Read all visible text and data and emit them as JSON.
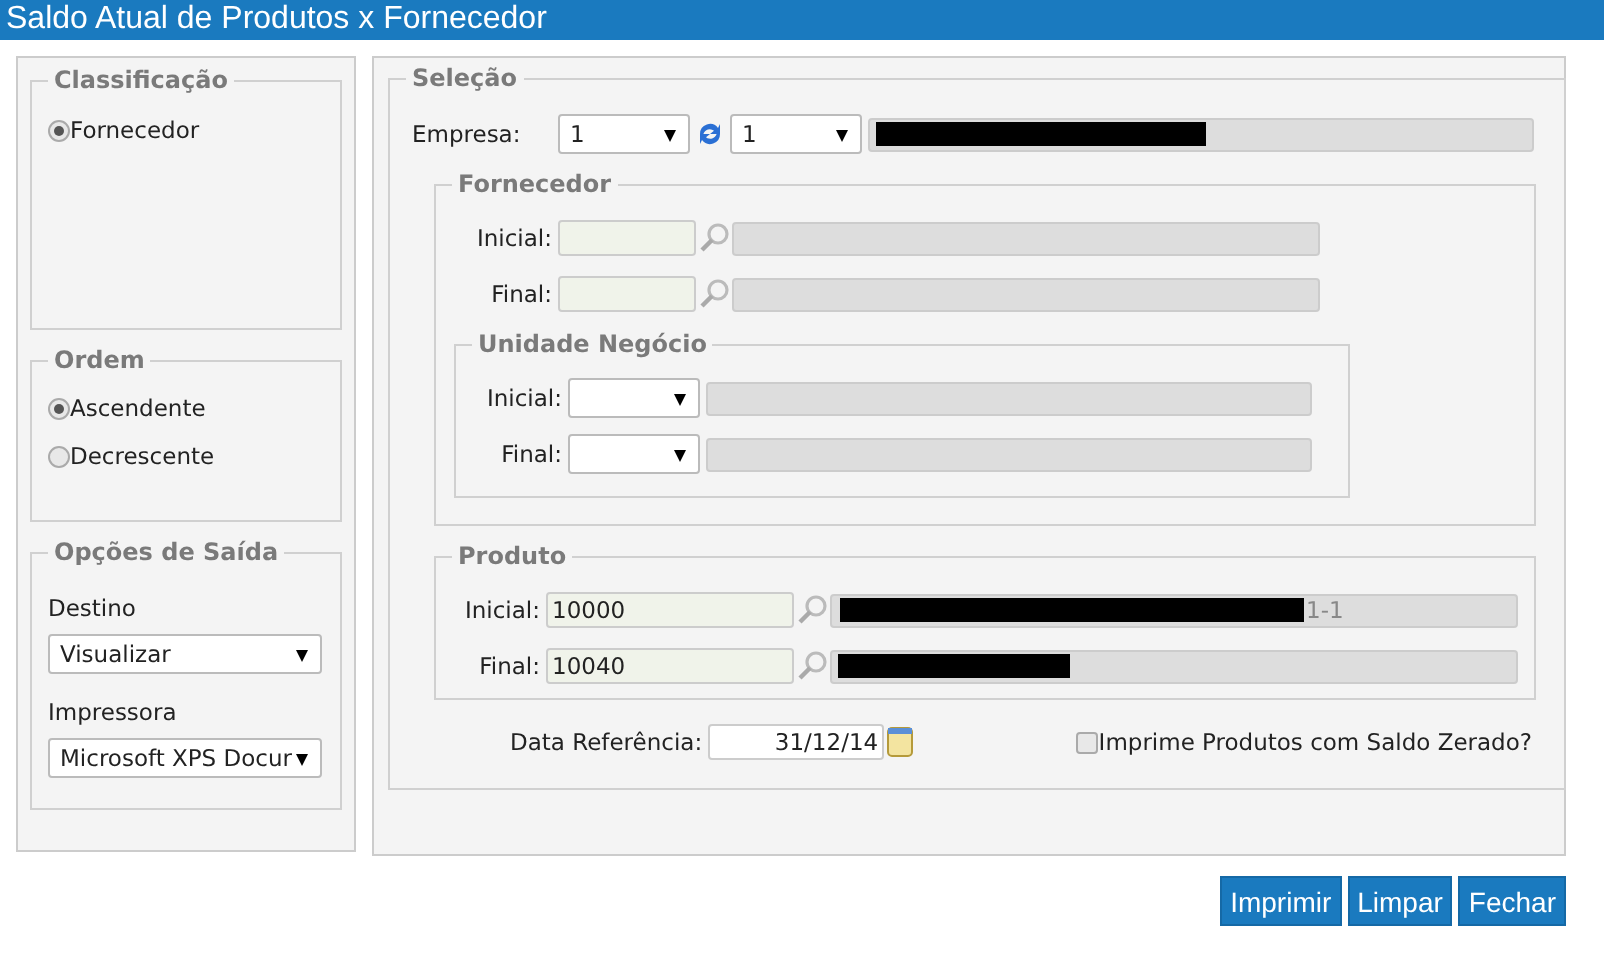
{
  "window": {
    "title": "Saldo Atual de Produtos x Fornecedor"
  },
  "classificacao": {
    "legend": "Classificação",
    "options": [
      {
        "label": "Fornecedor",
        "selected": true
      }
    ]
  },
  "ordem": {
    "legend": "Ordem",
    "options": [
      {
        "label": "Ascendente",
        "selected": true
      },
      {
        "label": "Decrescente",
        "selected": false
      }
    ]
  },
  "saida": {
    "legend": "Opções de Saída",
    "fields": [
      {
        "label": "Destino",
        "value": "Visualizar"
      },
      {
        "label": "Impressora",
        "value": "Microsoft XPS Docur"
      }
    ]
  },
  "selecao": {
    "legend": "Seleção",
    "empresa": {
      "label": "Empresa:",
      "value_1": "1",
      "value_2": "1",
      "description_redacted": true
    },
    "fornecedor": {
      "legend": "Fornecedor",
      "rows": [
        {
          "label": "Inicial:"
        },
        {
          "label": "Final:"
        }
      ]
    },
    "unidade": {
      "legend": "Unidade Negócio",
      "rows": [
        {
          "label": "Inicial:"
        },
        {
          "label": "Final:"
        }
      ]
    },
    "produto": {
      "legend": "Produto",
      "rows": [
        {
          "label": "Inicial:",
          "value": "10000",
          "description": "1-1",
          "redacted": true
        },
        {
          "label": "Final:",
          "value": "10040",
          "redacted": true
        }
      ]
    },
    "data_referencia": {
      "label": "Data Referência:",
      "value": "31/12/14"
    },
    "zerado": {
      "label": "Imprime Produtos com Saldo Zerado?",
      "checked": false
    }
  },
  "buttons": [
    "Imprimir",
    "Limpar",
    "Fechar"
  ]
}
